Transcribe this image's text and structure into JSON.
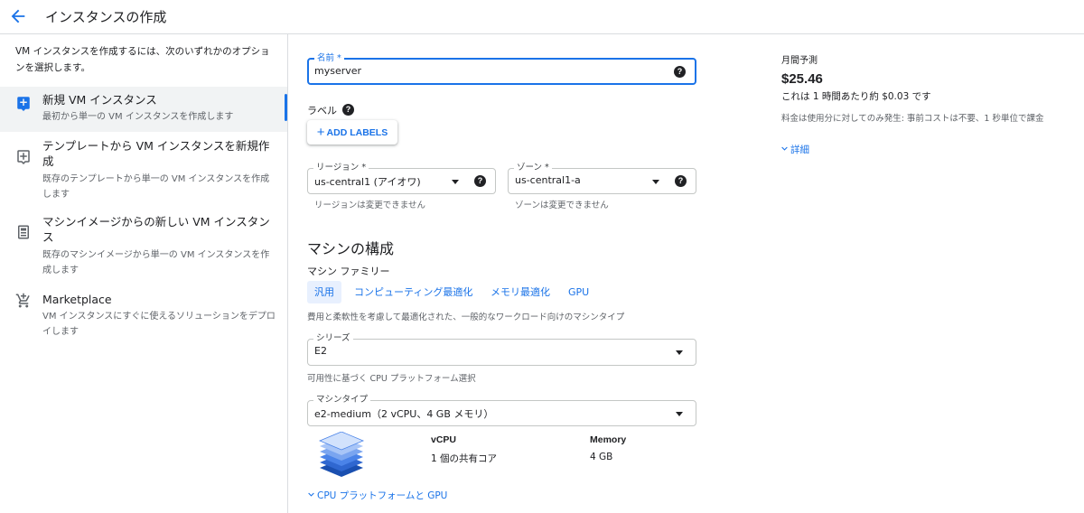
{
  "header": {
    "title": "インスタンスの作成"
  },
  "sidebar": {
    "intro": "VM インスタンスを作成するには、次のいずれかのオプションを選択します。",
    "options": [
      {
        "title": "新規 VM インスタンス",
        "desc": "最初から単一の VM インスタンスを作成します",
        "icon": "add-box-icon",
        "selected": true
      },
      {
        "title": "テンプレートから VM インスタンスを新規作成",
        "desc": "既存のテンプレートから単一の VM インスタンスを作成します",
        "icon": "template-icon",
        "selected": false
      },
      {
        "title": "マシンイメージからの新しい VM インスタンス",
        "desc": "既存のマシンイメージから単一の VM インスタンスを作成します",
        "icon": "machine-image-icon",
        "selected": false
      },
      {
        "title": "Marketplace",
        "desc": "VM インスタンスにすぐに使えるソリューションをデプロイします",
        "icon": "marketplace-cart-icon",
        "selected": false
      }
    ]
  },
  "form": {
    "name": {
      "label": "名前 *",
      "value": "myserver"
    },
    "labels": {
      "title": "ラベル",
      "add_button": "ADD LABELS"
    },
    "region": {
      "label": "リージョン *",
      "value": "us-central1 (アイオワ)",
      "hint": "リージョンは変更できません"
    },
    "zone": {
      "label": "ゾーン *",
      "value": "us-central1-a",
      "hint": "ゾーンは変更できません"
    },
    "machine": {
      "section_title": "マシンの構成",
      "family_label": "マシン ファミリー",
      "families": [
        "汎用",
        "コンピューティング最適化",
        "メモリ最適化",
        "GPU"
      ],
      "active_family": "汎用",
      "family_desc": "費用と柔軟性を考慮して最適化された、一般的なワークロード向けのマシンタイプ",
      "series": {
        "label": "シリーズ",
        "value": "E2",
        "hint": "可用性に基づく CPU プラットフォーム選択"
      },
      "machine_type": {
        "label": "マシンタイプ",
        "value": "e2-medium（2 vCPU、4 GB メモリ）"
      },
      "specs": {
        "vcpu_header": "vCPU",
        "vcpu_value": "1 個の共有コア",
        "memory_header": "Memory",
        "memory_value": "4 GB"
      },
      "expand_link": "CPU プラットフォームと GPU"
    }
  },
  "estimate": {
    "label": "月間予測",
    "price": "$25.46",
    "hourly": "これは 1 時間あたり約 $0.03 です",
    "note": "料金は使用分に対してのみ発生: 事前コストは不要、1 秒単位で課金",
    "details": "詳細"
  },
  "colors": {
    "accent": "#1a73e8",
    "divider": "#dadce0",
    "selected_bg": "#f1f3f4",
    "text_secondary": "#5f6368"
  }
}
